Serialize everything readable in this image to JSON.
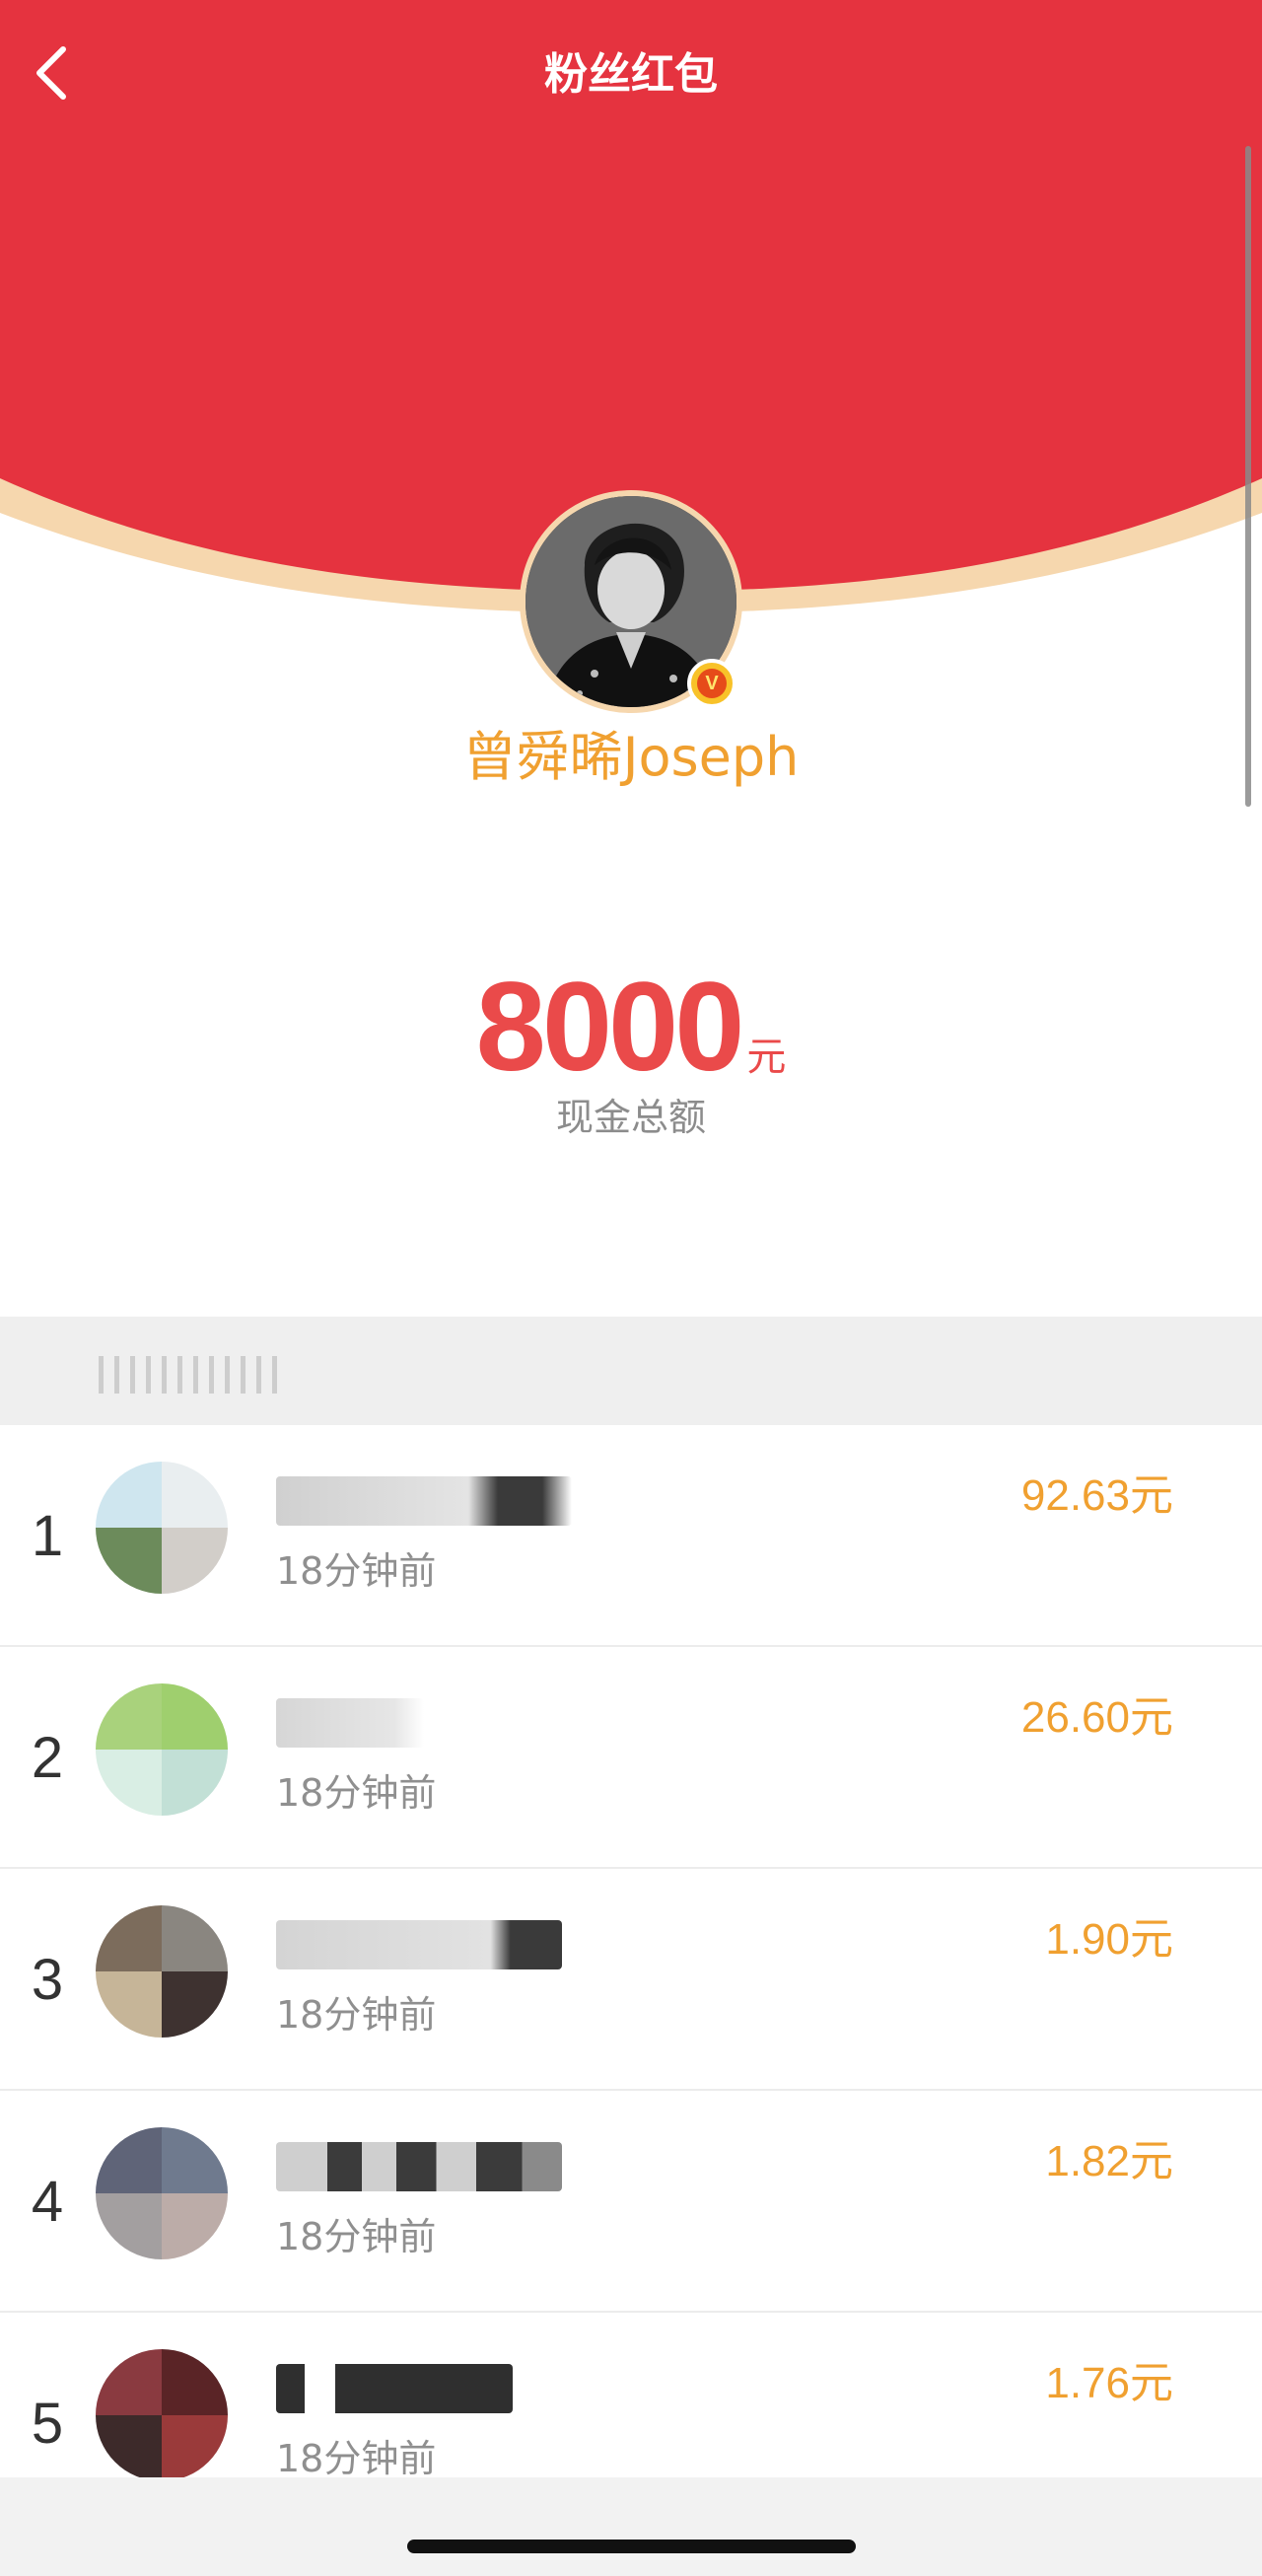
{
  "header": {
    "title": "粉丝红包",
    "back_icon": "chevron-left-icon",
    "background_color": "#e5333f"
  },
  "profile": {
    "username": "曾舜晞Joseph",
    "verified_badge": "V",
    "name_color": "#f0a030"
  },
  "total": {
    "amount": "8000",
    "unit": "元",
    "label": "现金总额",
    "amount_color": "#ea4a4a"
  },
  "recipients": [
    {
      "rank": "1",
      "time": "18分钟前",
      "amount": "92.63元"
    },
    {
      "rank": "2",
      "time": "18分钟前",
      "amount": "26.60元"
    },
    {
      "rank": "3",
      "time": "18分钟前",
      "amount": "1.90元"
    },
    {
      "rank": "4",
      "time": "18分钟前",
      "amount": "1.82元"
    },
    {
      "rank": "5",
      "time": "18分钟前",
      "amount": "1.76元"
    }
  ]
}
